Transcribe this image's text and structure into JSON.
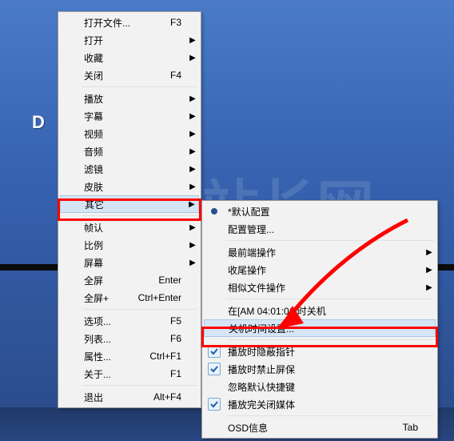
{
  "desktop_letter": "D",
  "watermark": "站长网",
  "menu1": {
    "open_file": "打开文件...",
    "open": "打开",
    "favorites": "收藏",
    "close": "关闭",
    "play": "播放",
    "subtitle": "字幕",
    "video": "视频",
    "audio": "音频",
    "filter": "滤镜",
    "skin": "皮肤",
    "other": "其它",
    "fps": "帧认",
    "ratio": "比例",
    "screen": "屏幕",
    "fs": "全屏",
    "fs_plus": "全屏+",
    "options": "选项...",
    "list": "列表...",
    "props": "属性...",
    "about": "关于...",
    "exit": "退出",
    "s_f3": "F3",
    "s_f4": "F4",
    "s_enter": "Enter",
    "s_ctrl_enter": "Ctrl+Enter",
    "s_f5": "F5",
    "s_f6": "F6",
    "s_ctrl_f1": "Ctrl+F1",
    "s_f1": "F1",
    "s_alt_f4": "Alt+F4"
  },
  "menu2": {
    "default_cfg": "*默认配置",
    "cfg_mgr": "配置管理...",
    "topmost": "最前端操作",
    "wrapup": "收尾操作",
    "similar": "相似文件操作",
    "shutdown_at": "在[AM 04:01:01]时关机",
    "shutdown_time": "关机时间设置...",
    "hide_pointer": "播放时隐蔽指针",
    "no_screensaver": "播放时禁止屏保",
    "ignore_shortcut": "忽略默认快捷键",
    "close_on_finish": "播放完关闭媒体",
    "osd_info": "OSD信息",
    "s_tab": "Tab"
  }
}
